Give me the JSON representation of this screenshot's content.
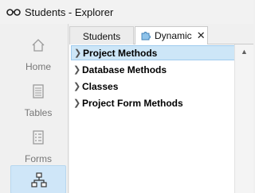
{
  "window": {
    "title": "Students - Explorer",
    "icon": "glasses-icon"
  },
  "sidebar": {
    "items": [
      {
        "label": "Home",
        "icon": "home-icon",
        "selected": false
      },
      {
        "label": "Tables",
        "icon": "tables-icon",
        "selected": false
      },
      {
        "label": "Forms",
        "icon": "forms-icon",
        "selected": false
      },
      {
        "label": "",
        "icon": "methods-icon",
        "selected": true
      }
    ]
  },
  "tabs": [
    {
      "label": "Students",
      "active": false
    },
    {
      "label": "Dynamic",
      "active": true,
      "icon": "puzzle-icon",
      "closable": true,
      "close_glyph": "✕"
    }
  ],
  "tree": {
    "items": [
      {
        "label": "Project Methods",
        "selected": true
      },
      {
        "label": "Database Methods",
        "selected": false
      },
      {
        "label": "Classes",
        "selected": false
      },
      {
        "label": "Project Form Methods",
        "selected": false
      }
    ]
  },
  "colors": {
    "selection": "#cde6f7",
    "selection_border": "#9fcbee"
  }
}
